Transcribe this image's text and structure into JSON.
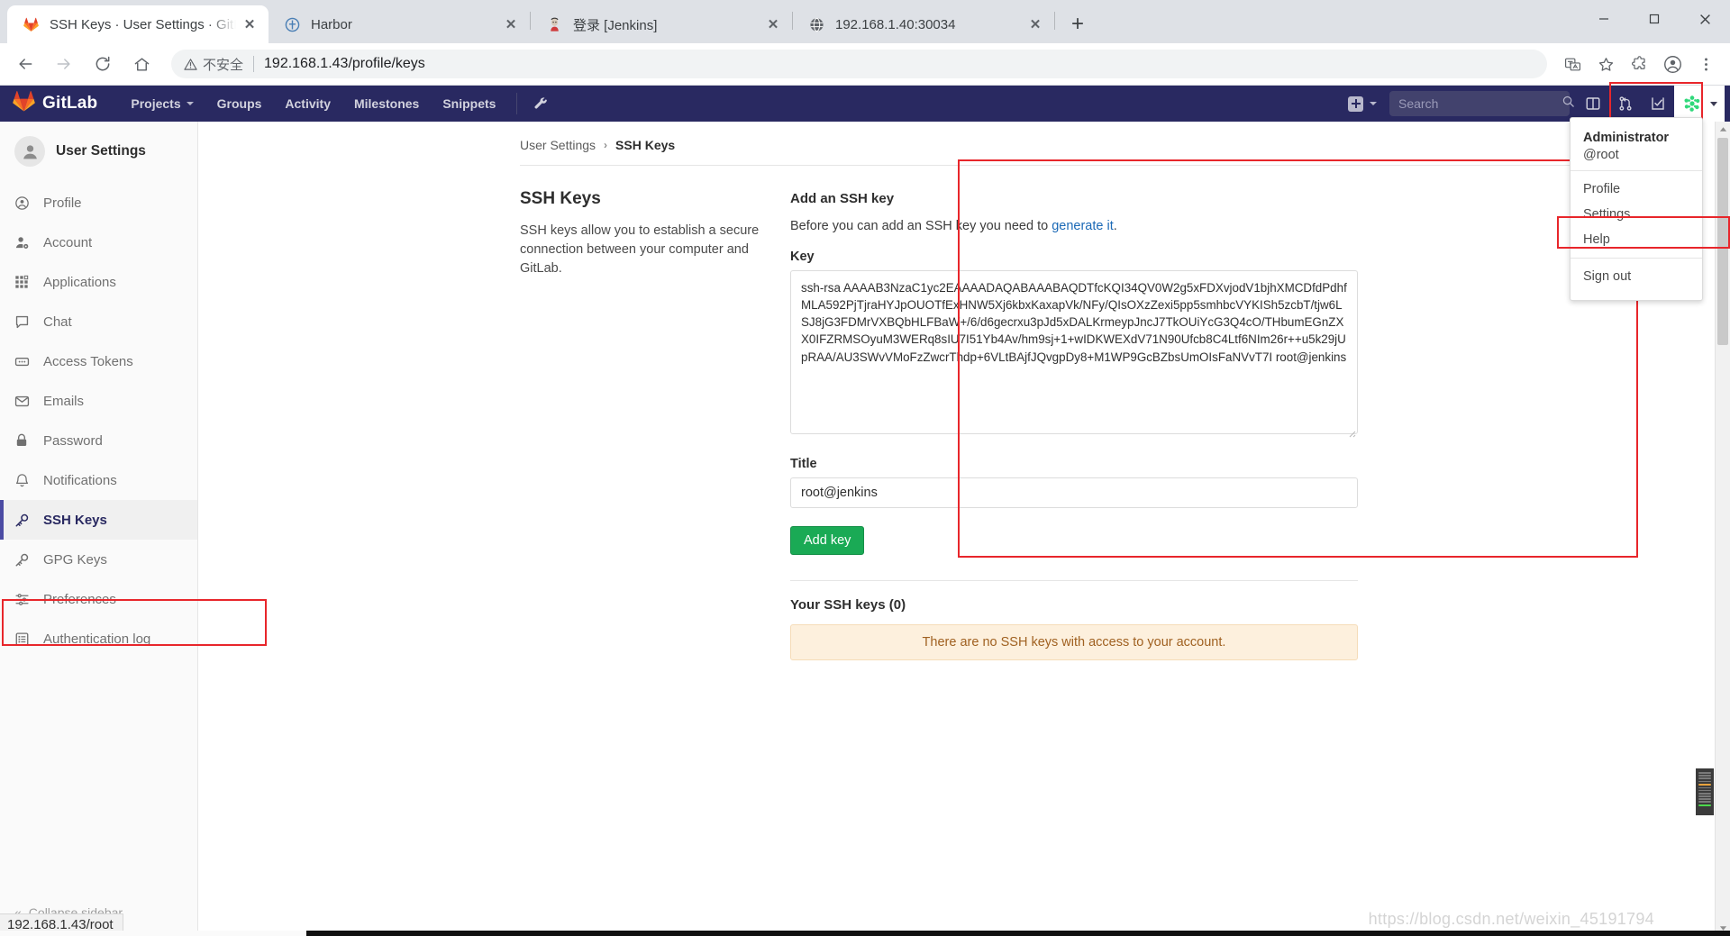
{
  "browser": {
    "tabs": [
      {
        "title": "SSH Keys · User Settings · GitLab",
        "favicon": "gitlab-icon",
        "active": true,
        "close_label": "✕"
      },
      {
        "title": "Harbor",
        "favicon": "harbor-icon",
        "active": false,
        "close_label": "✕"
      },
      {
        "title": "登录 [Jenkins]",
        "favicon": "jenkins-icon",
        "active": false,
        "close_label": "✕"
      },
      {
        "title": "192.168.1.40:30034",
        "favicon": "globe-icon",
        "active": false,
        "close_label": "✕"
      }
    ],
    "new_tab_label": "+",
    "window_controls": {
      "minimize": "minimize-icon",
      "maximize": "maximize-icon",
      "close": "close-icon"
    },
    "toolbar": {
      "back": "back-arrow-icon",
      "forward": "forward-arrow-icon",
      "reload": "reload-icon",
      "home": "home-icon",
      "security_label": "不安全",
      "url": "192.168.1.43/profile/keys",
      "translate": "translate-icon",
      "bookmark": "star-icon",
      "extensions": "puzzle-icon",
      "profile": "profile-avatar-icon",
      "menu": "more-vertical-icon"
    }
  },
  "navbar": {
    "brand": "GitLab",
    "brand_icon": "gitlab-tanuki-icon",
    "links": [
      {
        "label": "Projects",
        "has_caret": true
      },
      {
        "label": "Groups",
        "has_caret": false
      },
      {
        "label": "Activity",
        "has_caret": false
      },
      {
        "label": "Milestones",
        "has_caret": false
      },
      {
        "label": "Snippets",
        "has_caret": false
      }
    ],
    "admin_icon": "wrench-icon",
    "new_icon": "plus-square-icon",
    "search_placeholder": "Search",
    "search_value": "",
    "search_icon": "search-icon",
    "icons": [
      {
        "name": "issues-board-icon"
      },
      {
        "name": "merge-requests-icon"
      },
      {
        "name": "todos-icon"
      }
    ],
    "user_avatar_icon": "user-avatar-icon",
    "user_caret_icon": "chevron-down-icon"
  },
  "user_dropdown": {
    "name": "Administrator",
    "handle": "@root",
    "items": [
      {
        "label": "Profile"
      },
      {
        "label": "Settings",
        "highlighted": true
      },
      {
        "label": "Help"
      }
    ],
    "signout": "Sign out"
  },
  "sidebar": {
    "avatar_icon": "user-avatar-icon",
    "title": "User Settings",
    "items": [
      {
        "label": "Profile",
        "icon": "user-circle-icon",
        "active": false
      },
      {
        "label": "Account",
        "icon": "user-gear-icon",
        "active": false
      },
      {
        "label": "Applications",
        "icon": "grid-apps-icon",
        "active": false
      },
      {
        "label": "Chat",
        "icon": "chat-bubble-icon",
        "active": false
      },
      {
        "label": "Access Tokens",
        "icon": "token-icon",
        "active": false
      },
      {
        "label": "Emails",
        "icon": "envelope-icon",
        "active": false
      },
      {
        "label": "Password",
        "icon": "lock-icon",
        "active": false
      },
      {
        "label": "Notifications",
        "icon": "bell-icon",
        "active": false
      },
      {
        "label": "SSH Keys",
        "icon": "key-icon",
        "active": true
      },
      {
        "label": "GPG Keys",
        "icon": "key-icon",
        "active": false
      },
      {
        "label": "Preferences",
        "icon": "sliders-icon",
        "active": false
      },
      {
        "label": "Authentication log",
        "icon": "list-document-icon",
        "active": false
      }
    ],
    "collapse_label": "Collapse sidebar",
    "collapse_icon": "double-chevron-left-icon"
  },
  "breadcrumb": {
    "root": "User Settings",
    "separator": "›",
    "current": "SSH Keys"
  },
  "page": {
    "heading": "SSH Keys",
    "description": "SSH keys allow you to establish a secure connection between your computer and GitLab."
  },
  "form": {
    "title": "Add an SSH key",
    "subtitle_before": "Before you can add an SSH key you need to ",
    "subtitle_link": "generate it",
    "subtitle_after": ".",
    "key_label": "Key",
    "key_value": "ssh-rsa AAAAB3NzaC1yc2EAAAADAQABAAABAQDTfcKQI34QV0W2g5xFDXvjodV1bjhXMCDfdPdhfMLA592PjTjraHYJpOUOTfExHNW5Xj6kbxKaxapVk/NFy/QIsOXzZexi5pp5smhbcVYKISh5zcbT/tjw6LSJ8jG3FDMrVXBQbHLFBaW+/6/d6gecrxu3pJd5xDALKrmeypJncJ7TkOUiYcG3Q4cO/THbumEGnZXX0IFZRMSOyuM3WERq8sIU7I51Yb4Av/hm9sj+1+wIDKWEXdV71N90Ufcb8C4Ltf6NIm26r++u5k29jUpRAA/AU3SWvVMoFzZwcrThdp+6VLtBAjfJQvgpDy8+M1WP9GcBZbsUmOIsFaNVvT7I root@jenkins",
    "key_placeholder": "",
    "title_label": "Title",
    "title_value": "root@jenkins",
    "title_placeholder": "",
    "submit_label": "Add key"
  },
  "keys_section": {
    "heading": "Your SSH keys (0)",
    "empty_message": "There are no SSH keys with access to your account."
  },
  "status": {
    "link_preview": "192.168.1.43/root"
  },
  "watermark": "https://blog.csdn.net/weixin_45191794",
  "colors": {
    "gitlab_navbar": "#292961",
    "accent_green": "#1aaa55",
    "link_blue": "#1b69b6",
    "highlight_red": "#e8262b",
    "warning_bg": "#fdf0dd",
    "warning_text": "#a06121"
  }
}
